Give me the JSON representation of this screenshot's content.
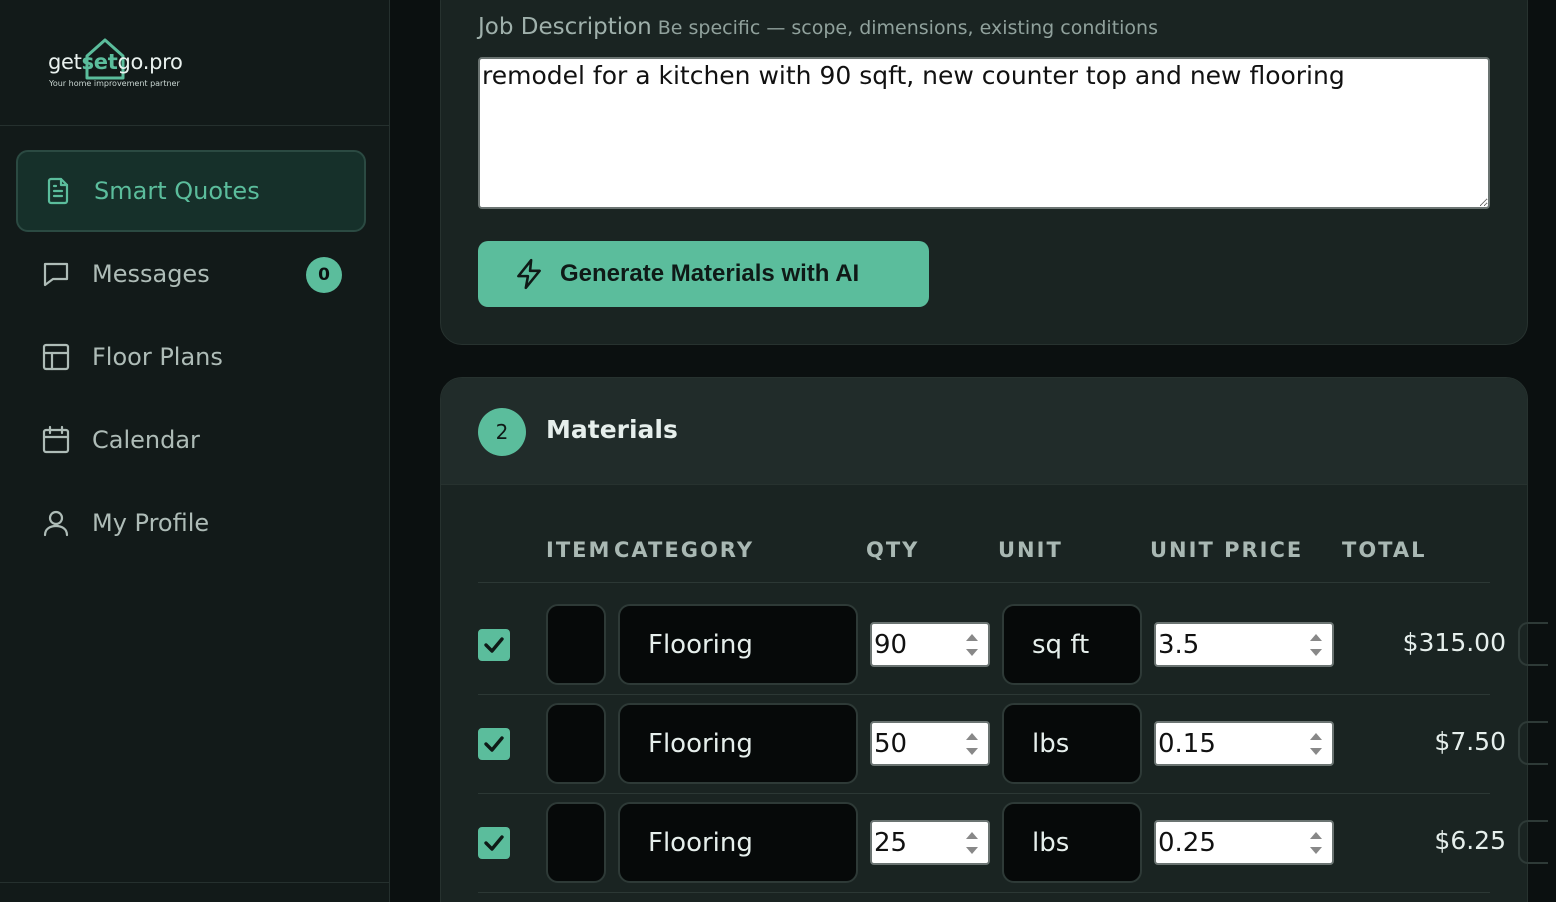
{
  "brand": {
    "prefix": "get",
    "accent": "set",
    "suffix": "go.pro",
    "tagline": "Your home improvement partner"
  },
  "nav": {
    "items": [
      {
        "label": "Smart Quotes",
        "icon": "document-icon",
        "active": true
      },
      {
        "label": "Messages",
        "icon": "chat-icon",
        "badge": "0"
      },
      {
        "label": "Floor Plans",
        "icon": "layout-icon"
      },
      {
        "label": "Calendar",
        "icon": "calendar-icon"
      },
      {
        "label": "My Profile",
        "icon": "user-icon"
      }
    ]
  },
  "job": {
    "label": "Job Description",
    "hint": "Be specific — scope, dimensions, existing conditions",
    "value": "remodel for a kitchen with 90 sqft, new counter top and new flooring",
    "generate_label": "Generate Materials with AI"
  },
  "materials": {
    "step": "2",
    "title": "Materials",
    "columns": [
      "ITEM",
      "CATEGORY",
      "QTY",
      "UNIT",
      "UNIT PRICE",
      "TOTAL"
    ],
    "rows": [
      {
        "checked": true,
        "item": "",
        "category": "Flooring",
        "qty": "90",
        "unit": "sq ft",
        "unit_price": "3.5",
        "total": "$315.00"
      },
      {
        "checked": true,
        "item": "",
        "category": "Flooring",
        "qty": "50",
        "unit": "lbs",
        "unit_price": "0.15",
        "total": "$7.50"
      },
      {
        "checked": true,
        "item": "",
        "category": "Flooring",
        "qty": "25",
        "unit": "lbs",
        "unit_price": "0.25",
        "total": "$6.25"
      }
    ]
  },
  "colors": {
    "accent": "#5bbd9c",
    "background": "#0b1010",
    "sidebar": "#121a19",
    "card": "#1a2422"
  }
}
